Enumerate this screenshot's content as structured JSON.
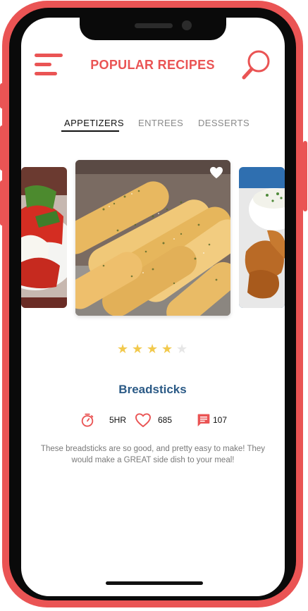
{
  "header": {
    "title": "POPULAR RECIPES"
  },
  "tabs": [
    {
      "label": "APPETIZERS",
      "active": true
    },
    {
      "label": "ENTREES",
      "active": false
    },
    {
      "label": "DESSERTS",
      "active": false
    }
  ],
  "recipe": {
    "name": "Breadsticks",
    "rating": 4,
    "rating_max": 5,
    "time": "5HR",
    "likes": "685",
    "comments": "107",
    "description": "These breadsticks are so good, and pretty easy to make!  They would make a GREAT side dish to your meal!"
  },
  "colors": {
    "accent": "#ea5454",
    "title_blue": "#2b5a86",
    "star": "#f2c94c",
    "star_empty": "#e0e0e0"
  },
  "icons": {
    "menu": "hamburger-menu-icon",
    "search": "search-icon",
    "timer": "timer-icon",
    "likes": "heart-icon",
    "comments": "comment-icon",
    "favorite": "heart-icon"
  }
}
